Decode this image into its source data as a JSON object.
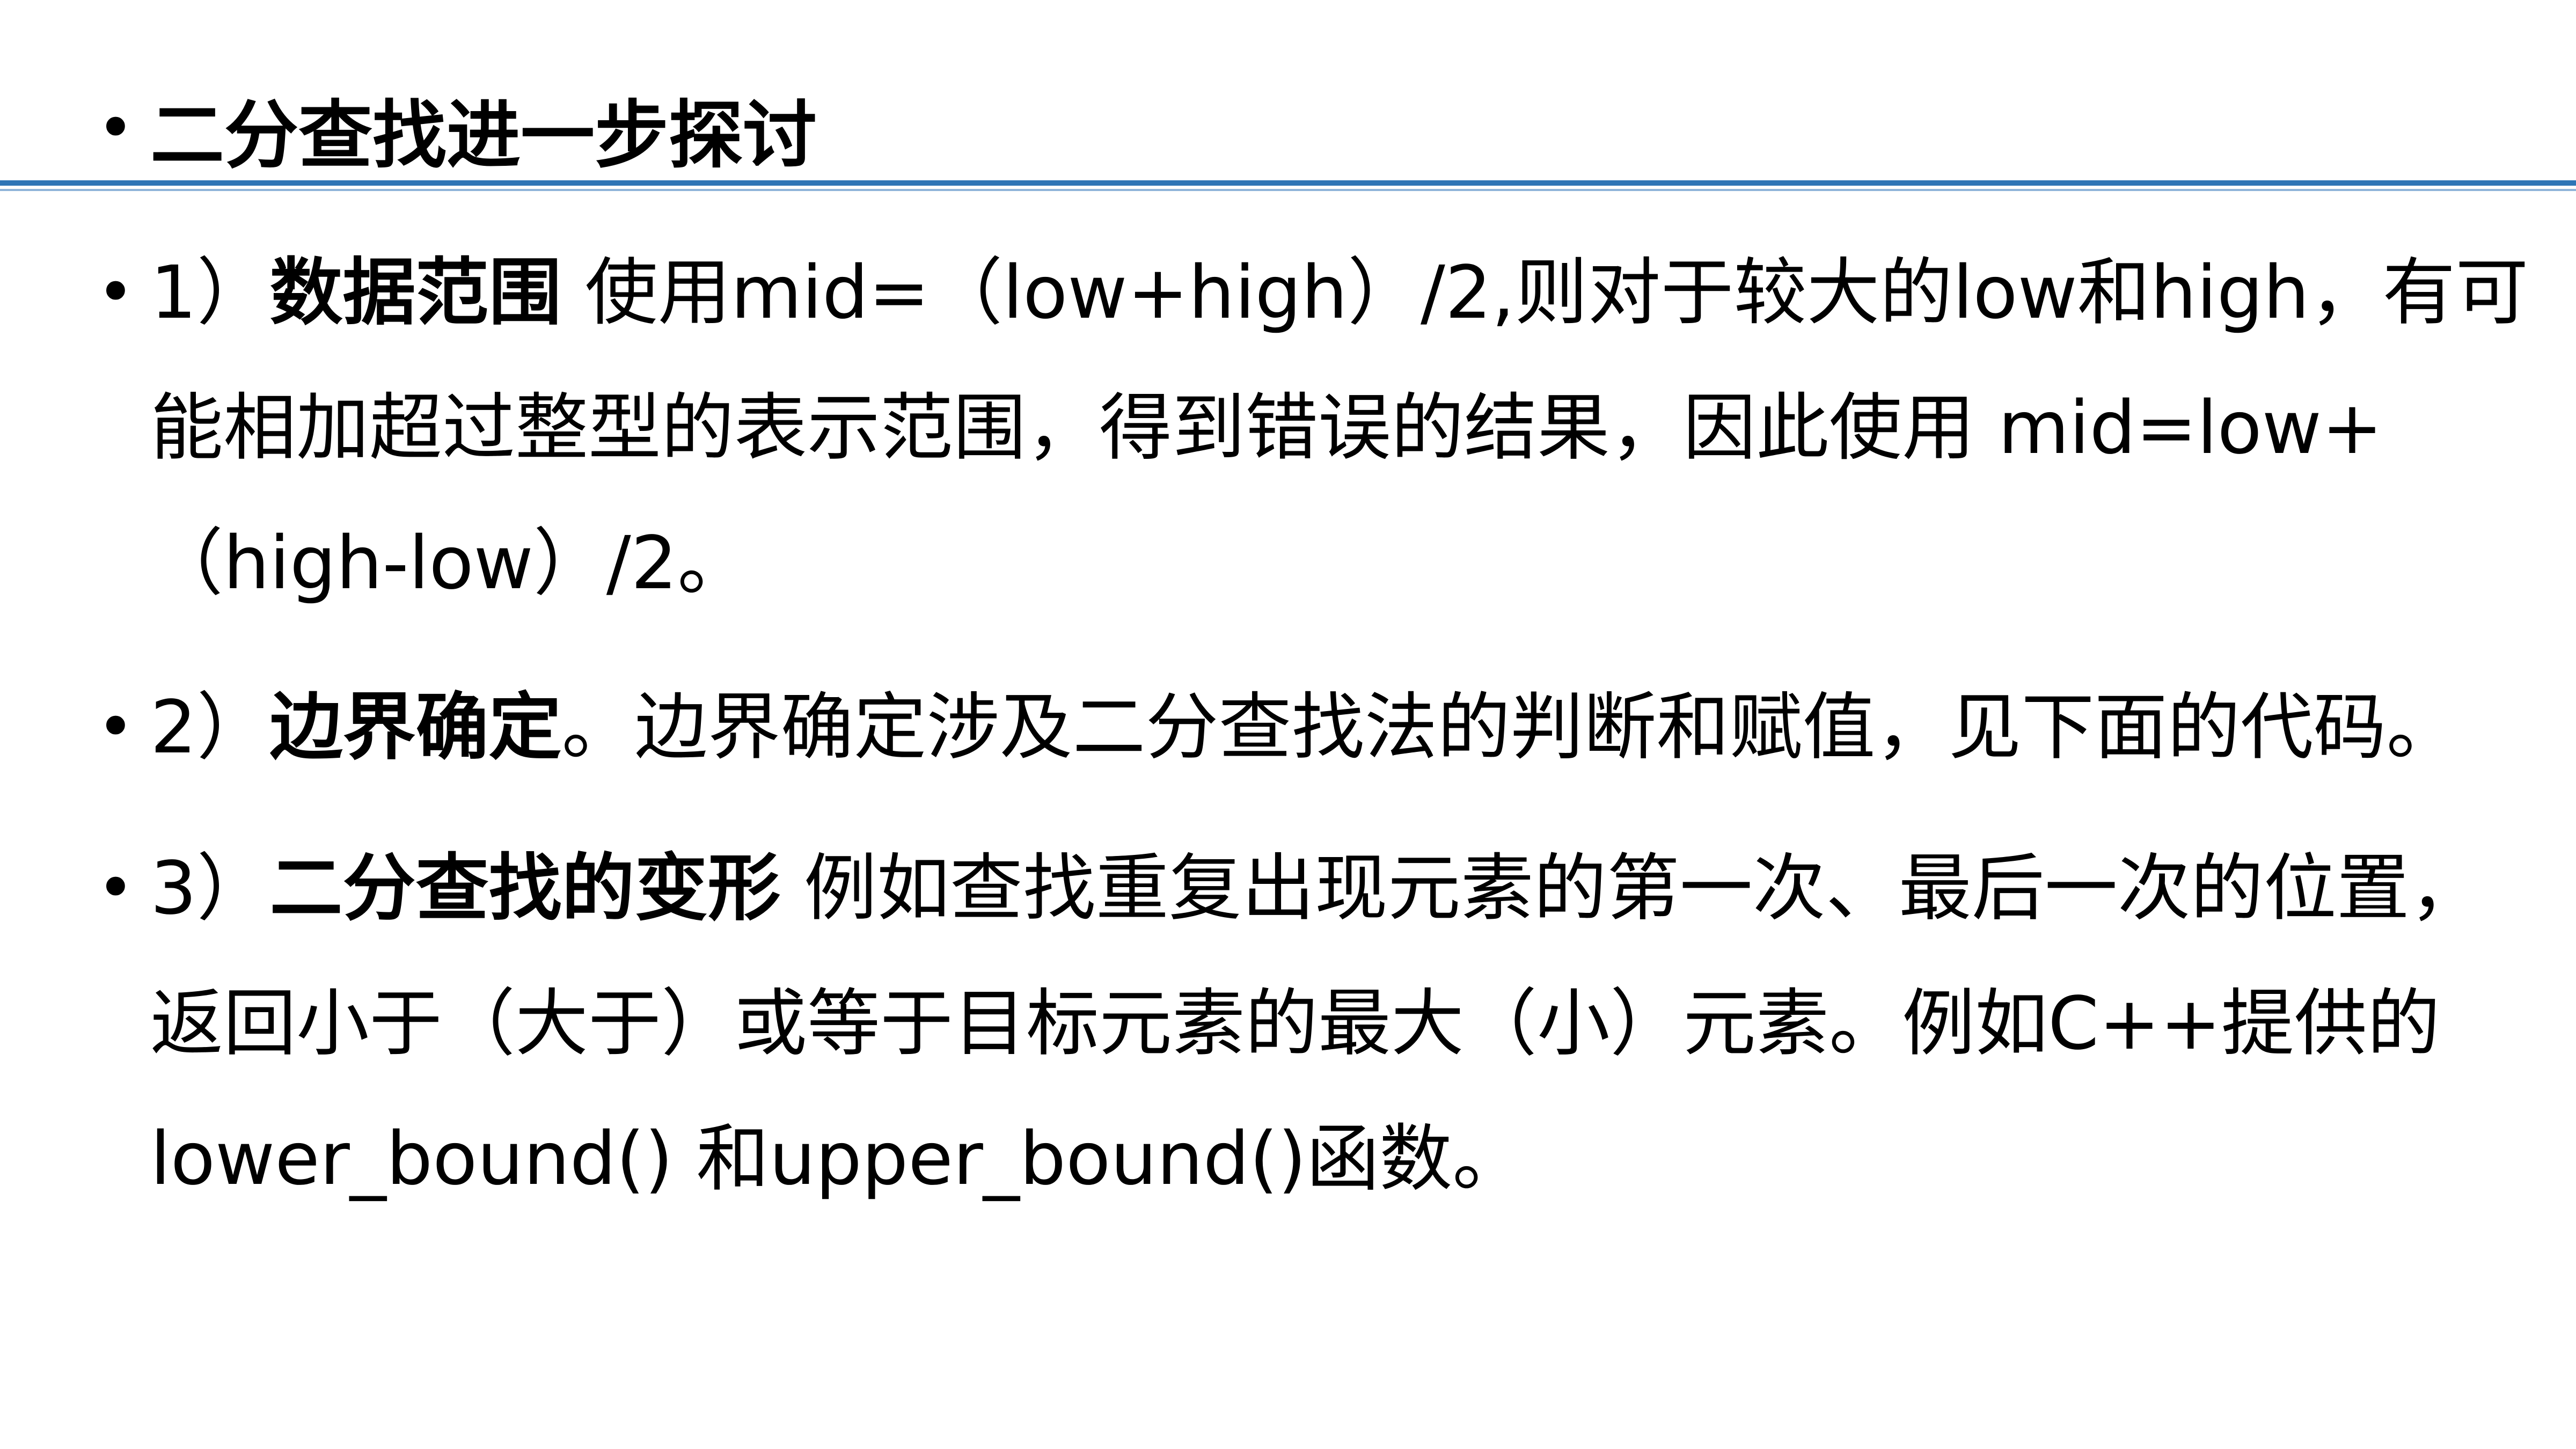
{
  "title": {
    "bullet": "•",
    "text": "二分查找进一步探讨"
  },
  "items": [
    {
      "bullet": "•",
      "prefix": "1）",
      "bold": "数据范围",
      "lines": [
        " 使用mid=（low+high）/2,则对于较大的low和high，有可",
        "能相加超过整型的表示范围，得到错误的结果，因此使用 mid=low+",
        "（high-low）/2。"
      ]
    },
    {
      "bullet": "•",
      "prefix": "2）",
      "bold": "边界确定",
      "lines": [
        "。边界确定涉及二分查找法的判断和赋值，见下面的代码。"
      ]
    },
    {
      "bullet": "•",
      "prefix": "3）",
      "bold": "二分查找的变形",
      "lines": [
        " 例如查找重复出现元素的第一次、最后一次的位置，",
        "返回小于（大于）或等于目标元素的最大（小）元素。例如C++提供的",
        "lower_bound() 和upper_bound()函数。"
      ]
    }
  ],
  "colors": {
    "rule": "#2e75b6",
    "rule_light": "#8fb4d9",
    "text": "#000000",
    "background": "#ffffff"
  }
}
